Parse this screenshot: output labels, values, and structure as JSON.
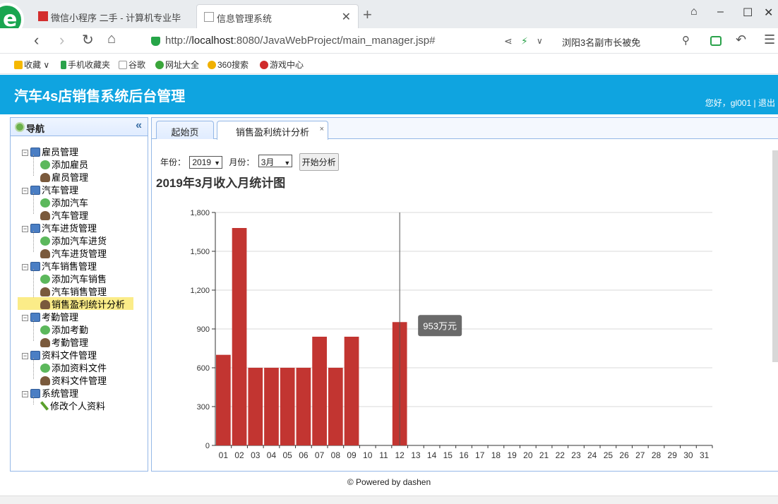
{
  "browser": {
    "tabs": [
      {
        "title": "微信小程序 二手 - 计算机专业毕"
      },
      {
        "title": "信息管理系统",
        "active": true
      }
    ],
    "url": {
      "protocol": "http://",
      "host": "localhost",
      "rest": ":8080/JavaWebProject/main_manager.jsp#"
    },
    "news_ticker": "浏阳3名副市长被免",
    "bookmarks": [
      "收藏",
      "手机收藏夹",
      "谷歌",
      "网址大全",
      "360搜索",
      "游戏中心"
    ]
  },
  "app": {
    "title": "汽车4s店销售系统后台管理",
    "greeting": "您好，gl001",
    "logout": "退出"
  },
  "nav": {
    "heading": "导航",
    "groups": [
      {
        "label": "雇员管理",
        "items": [
          {
            "label": "添加雇员",
            "icon": "add-icon"
          },
          {
            "label": "雇员管理",
            "icon": "user-icon"
          }
        ]
      },
      {
        "label": "汽车管理",
        "items": [
          {
            "label": "添加汽车",
            "icon": "add-icon"
          },
          {
            "label": "汽车管理",
            "icon": "user-icon"
          }
        ]
      },
      {
        "label": "汽车进货管理",
        "items": [
          {
            "label": "添加汽车进货",
            "icon": "add-icon"
          },
          {
            "label": "汽车进货管理",
            "icon": "user-icon"
          }
        ]
      },
      {
        "label": "汽车销售管理",
        "items": [
          {
            "label": "添加汽车销售",
            "icon": "add-icon"
          },
          {
            "label": "汽车销售管理",
            "icon": "user-icon"
          },
          {
            "label": "销售盈利统计分析",
            "icon": "user-icon",
            "selected": true
          }
        ]
      },
      {
        "label": "考勤管理",
        "items": [
          {
            "label": "添加考勤",
            "icon": "add-icon"
          },
          {
            "label": "考勤管理",
            "icon": "user-icon"
          }
        ]
      },
      {
        "label": "资料文件管理",
        "items": [
          {
            "label": "添加资料文件",
            "icon": "add-icon"
          },
          {
            "label": "资料文件管理",
            "icon": "user-icon"
          }
        ]
      },
      {
        "label": "系统管理",
        "items": [
          {
            "label": "修改个人资料",
            "icon": "pen-icon"
          }
        ]
      }
    ]
  },
  "tabs": {
    "home": "起始页",
    "stats": "销售盈利统计分析",
    "close": "×"
  },
  "filters": {
    "year_label": "年份：",
    "year_value": "2019",
    "month_label": "月份：",
    "month_value": "3月",
    "button": "开始分析"
  },
  "chart_title": "2019年3月收入月统计图",
  "footer": "© Powered by dashen",
  "chart_data": {
    "type": "bar",
    "title": "2019年3月收入月统计图",
    "categories": [
      "01",
      "02",
      "03",
      "04",
      "05",
      "06",
      "07",
      "08",
      "09",
      "10",
      "11",
      "12",
      "13",
      "14",
      "15",
      "16",
      "17",
      "18",
      "19",
      "20",
      "21",
      "22",
      "23",
      "24",
      "25",
      "26",
      "27",
      "28",
      "29",
      "30",
      "31"
    ],
    "values": [
      700,
      1680,
      600,
      600,
      600,
      600,
      840,
      600,
      840,
      0,
      0,
      953,
      0,
      0,
      0,
      0,
      0,
      0,
      0,
      0,
      0,
      0,
      0,
      0,
      0,
      0,
      0,
      0,
      0,
      0,
      0
    ],
    "ylim": [
      0,
      1800
    ],
    "yticks": [
      0,
      300,
      600,
      900,
      1200,
      1500,
      1800
    ],
    "ytick_labels": [
      "0",
      "300",
      "600",
      "900",
      "1,200",
      "1,500",
      "1,800"
    ],
    "bar_color": "#c23531",
    "grid": true,
    "tooltip": {
      "category": "12",
      "text": "953万元"
    }
  }
}
